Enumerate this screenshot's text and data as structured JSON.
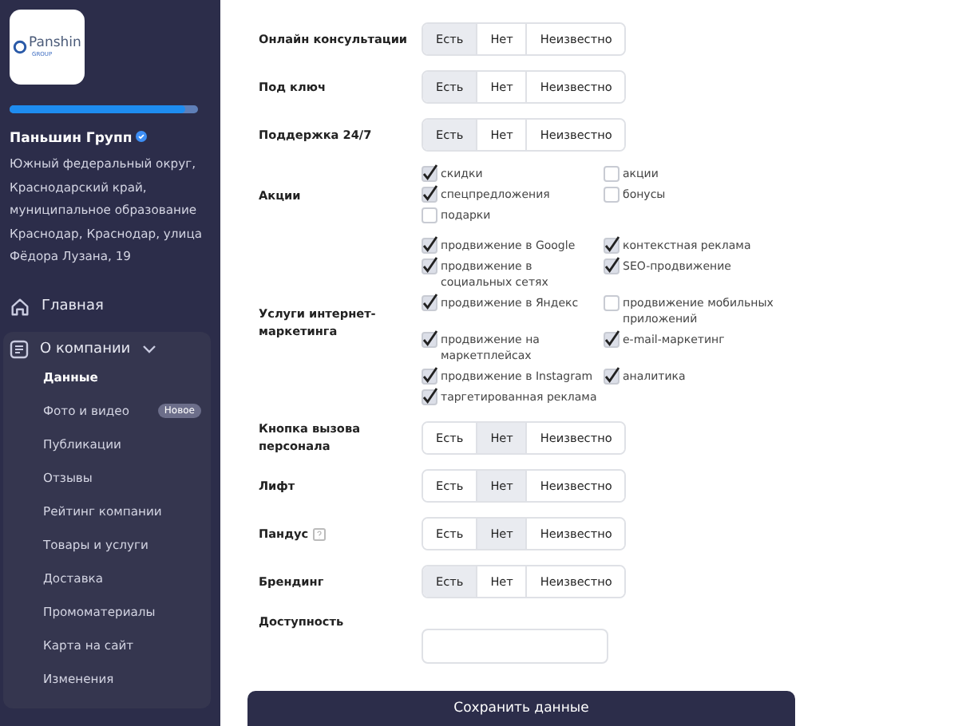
{
  "sidebar": {
    "logo": {
      "title": "Panshin",
      "subtitle": "GROUP"
    },
    "progress": {
      "level": 0.93
    },
    "company": {
      "name": "Паньшин Групп",
      "verified": true,
      "address": "Южный федеральный округ, Краснодарский край, муниципальное образование Краснодар, Краснодар, улица Фёдора Лузана, 19"
    },
    "nav": [
      {
        "label": "Главная"
      }
    ],
    "group": {
      "label": "О компании",
      "expanded": true,
      "items": [
        {
          "label": "Данные",
          "selected": true
        },
        {
          "label": "Фото и видео",
          "selected": false,
          "badge": "Новое"
        },
        {
          "label": "Публикации",
          "selected": false
        },
        {
          "label": "Отзывы",
          "selected": false
        },
        {
          "label": "Рейтинг компании",
          "selected": false
        },
        {
          "label": "Товары и услуги",
          "selected": false
        },
        {
          "label": "Доставка",
          "selected": false
        },
        {
          "label": "Промоматериалы",
          "selected": false
        },
        {
          "label": "Карта на сайт",
          "selected": false
        },
        {
          "label": "Изменения",
          "selected": false
        }
      ]
    }
  },
  "rows": [
    {
      "kind": "segmented",
      "label": "Онлайн консультации",
      "options": [
        {
          "label": "Есть",
          "selected": true
        },
        {
          "label": "Нет",
          "selected": false
        },
        {
          "label": "Неизвестно",
          "selected": false
        }
      ]
    },
    {
      "kind": "segmented",
      "label": "Под ключ",
      "options": [
        {
          "label": "Есть",
          "selected": true
        },
        {
          "label": "Нет",
          "selected": false
        },
        {
          "label": "Неизвестно",
          "selected": false
        }
      ]
    },
    {
      "kind": "segmented",
      "label": "Поддержка 24/7",
      "options": [
        {
          "label": "Есть",
          "selected": true
        },
        {
          "label": "Нет",
          "selected": false
        },
        {
          "label": "Неизвестно",
          "selected": false
        }
      ]
    },
    {
      "kind": "checklist",
      "label": "Акции",
      "items": [
        {
          "label": "скидки",
          "checked": true
        },
        {
          "label": "акции",
          "checked": false
        },
        {
          "label": "спецпредложения",
          "checked": true
        },
        {
          "label": "бонусы",
          "checked": false
        },
        {
          "label": "подарки",
          "checked": false
        }
      ]
    },
    {
      "kind": "checklist",
      "label": "Услуги интернет-маркетинга",
      "items": [
        {
          "label": "продвижение в Google",
          "checked": true
        },
        {
          "label": "контекстная реклама",
          "checked": true
        },
        {
          "label": "продвижение в социальных сетях",
          "checked": true
        },
        {
          "label": "SEO-продвижение",
          "checked": true
        },
        {
          "label": "продвижение в Яндекс",
          "checked": true
        },
        {
          "label": "продвижение мобильных приложений",
          "checked": false
        },
        {
          "label": "продвижение на маркетплейсах",
          "checked": true
        },
        {
          "label": "e-mail-маркетинг",
          "checked": true
        },
        {
          "label": "продвижение в Instagram",
          "checked": true
        },
        {
          "label": "аналитика",
          "checked": true
        },
        {
          "label": "таргетированная реклама",
          "checked": true
        }
      ]
    },
    {
      "kind": "segmented",
      "label": "Кнопка вызова персонала",
      "options": [
        {
          "label": "Есть",
          "selected": false
        },
        {
          "label": "Нет",
          "selected": true
        },
        {
          "label": "Неизвестно",
          "selected": false
        }
      ]
    },
    {
      "kind": "segmented",
      "label": "Лифт",
      "options": [
        {
          "label": "Есть",
          "selected": false
        },
        {
          "label": "Нет",
          "selected": true
        },
        {
          "label": "Неизвестно",
          "selected": false
        }
      ]
    },
    {
      "kind": "segmented",
      "label": "Пандус",
      "help": true,
      "options": [
        {
          "label": "Есть",
          "selected": false
        },
        {
          "label": "Нет",
          "selected": true
        },
        {
          "label": "Неизвестно",
          "selected": false
        }
      ]
    },
    {
      "kind": "segmented",
      "label": "Брендинг",
      "options": [
        {
          "label": "Есть",
          "selected": true
        },
        {
          "label": "Нет",
          "selected": false
        },
        {
          "label": "Неизвестно",
          "selected": false
        }
      ]
    },
    {
      "kind": "select",
      "label": "Доступность"
    }
  ],
  "save_button": "Сохранить данные"
}
